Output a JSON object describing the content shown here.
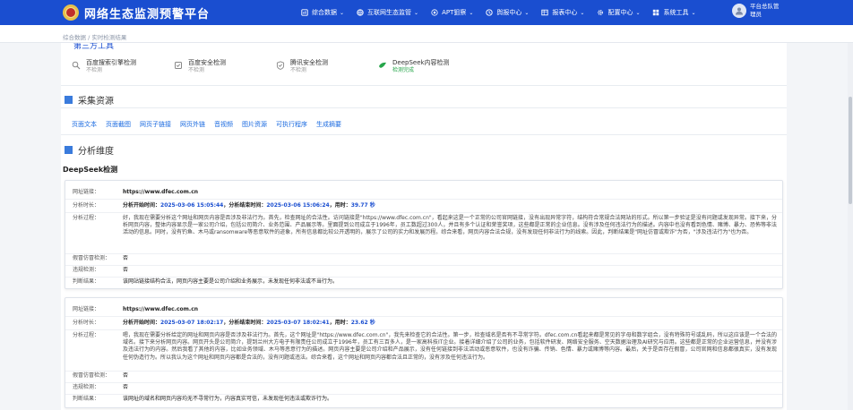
{
  "app": {
    "title": "网络生态监测预警平台",
    "colors": {
      "header": "#1a4ed0",
      "accent": "#1a6ae0",
      "ok": "#27a64b"
    }
  },
  "nav": {
    "items": [
      {
        "label": "综合数据",
        "icon": "data-icon"
      },
      {
        "label": "互联网生态监管",
        "icon": "globe-icon"
      },
      {
        "label": "APT狙察",
        "icon": "target-icon"
      },
      {
        "label": "舆报中心",
        "icon": "report-icon"
      },
      {
        "label": "报表中心",
        "icon": "table-icon"
      },
      {
        "label": "配置中心",
        "icon": "gear-icon"
      },
      {
        "label": "系统工具",
        "icon": "tool-icon"
      }
    ]
  },
  "user": {
    "line1": "平台总队管",
    "line2": "理员"
  },
  "breadcrumb": {
    "text": "综合数据  /  实时检测结果"
  },
  "third_party": {
    "title": "第三方工具",
    "items": [
      {
        "name": "百度搜索引擎检测",
        "status": "不检测",
        "icon": "search-engine-icon"
      },
      {
        "name": "百度安全检测",
        "status": "不检测",
        "icon": "shield-icon"
      },
      {
        "name": "腾讯安全检测",
        "status": "不检测",
        "icon": "check-shield-icon"
      },
      {
        "name": "DeepSeek内容检测",
        "status": "检测完成",
        "icon": "deepseek-icon"
      }
    ]
  },
  "collect": {
    "title": "采集资源",
    "tags": [
      "页面文本",
      "页面截图",
      "网页子链接",
      "网页外链",
      "音视频",
      "图片资源",
      "可执行程序",
      "生成摘要"
    ]
  },
  "analysis": {
    "title": "分析维度"
  },
  "deepseek": {
    "title": "DeepSeek检测",
    "records": [
      {
        "labels": {
          "url": "网址链接：",
          "time": "分析时长：",
          "process": "分析过程：",
          "fake": "假冒仿冒检测：",
          "illegal": "违规检测：",
          "result": "判断结果："
        },
        "url": "https://www.dfec.com.cn",
        "start_label": "分析开始时间：",
        "start": "2025-03-06 15:05:44",
        "end_label": "，分析结束时间：",
        "end": "2025-03-06 15:06:24",
        "dur_label": "，用时：",
        "duration": "39.77 秒",
        "process": "好，我现在需要分析这个网址和网页内容是否涉及非法行为。首先，检查网址的合法性。访问链接是\"https://www.dfec.com.cn\"，看起来这是一个正常的公司官网链接，没有出现异常字符，结构符合常规合法网站的形式。所以第一步验证是没有问题或发现异常。接下来，分析网页内容，整体内容显示是一家公司介绍，包括公司简介、业务范围、产品展示等。里面提到公司成立于1996年，员工数超过300人，并且有多个认证和荣誉奖项，这些都是正常的企业信息。没有涉及任何违法行为的描述。内容中也没有看到色情、赌博、暴力、恐怖等非法活动的信息。同时，没有钓鱼、木马或ransomware等恶意软件的迹象，所有信息都比较公开透明的，展示了公司的实力和发展历程。综合来看，网页内容合法合规，没有发现任何非法行为的线索。因此，判断结果是\"网址仿冒或欺诈\"为否，\"涉及违法行为\"也为否。",
        "fake": "否",
        "illegal": "否",
        "result": "该网站链接结构合法，网页内容主要是公司介绍和业务展示，未发现任何非法或不当行为。"
      },
      {
        "labels": {
          "url": "网址链接：",
          "time": "分析时长：",
          "process": "分析过程：",
          "fake": "假冒仿冒检测：",
          "illegal": "违规检测：",
          "result": "判断结果："
        },
        "url": "https://www.dfec.com.cn",
        "start_label": "分析开始时间：",
        "start": "2025-03-07 18:02:17",
        "end_label": "，分析结束时间：",
        "end": "2025-03-07 18:02:41",
        "dur_label": "，用时：",
        "duration": "23.62 秒",
        "process": "嗯，我现在需要分析给定的网址和网页内容是否涉及非法行为。首先，这个网址是\"https://www.dfec.com.cn\"，我先来检查它的合法性。第一步，检查域名是否有不寻常字符。dfec.com.cn看起来都是常见的字母和数字组合，没有特殊符号或乱码，所以这应该是一个合法的域名。接下来分析网页内容。网页开头是公司简介，提到兰州大方电子有限责任公司成立于1996年，员工有三百多人，是一家高科技IT企业。接着详细介绍了公司的业务，包括软件研发、网络安全服务、空天数据治理及AI研究与应用。这些都是正常的企业运营信息，并没有涉及违法行为的内容。然后我看了其他的内容，比如业务领域、木马等恶意行为的描述。网页内容主要是公司介绍和产品展示，没有任何链接到非法活动或恶意软件，也没有诈骗、传销、色情、暴力或赌博等内容。最后，关于是否存在假冒，公司官网和信息都很真实，没有发现任何伪造行为。所以我认为这个网址和网页内容都是合法的，没有问题或违法。综合来看，这个网址和网页内容都合法且正常的，没有涉及任何违法行为。",
        "fake": "否",
        "illegal": "否",
        "result": "该网址的域名和网页内容均无不寻常行为，内容真实可信，未发现任何违法或欺诈行为。"
      }
    ]
  }
}
